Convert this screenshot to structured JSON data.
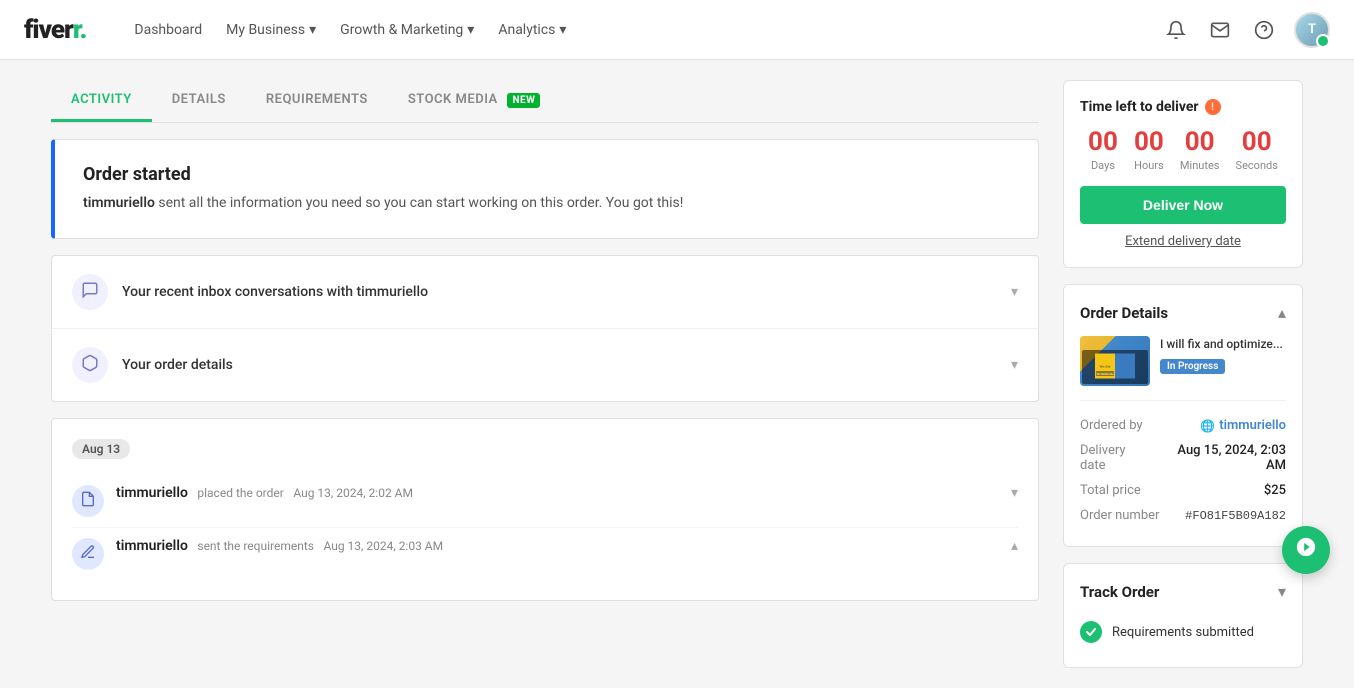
{
  "navbar": {
    "logo": "fiverr.",
    "links": [
      {
        "label": "Dashboard",
        "id": "dashboard"
      },
      {
        "label": "My Business",
        "id": "my-business",
        "dropdown": true
      },
      {
        "label": "Growth & Marketing",
        "id": "growth-marketing",
        "dropdown": true
      },
      {
        "label": "Analytics",
        "id": "analytics",
        "dropdown": true
      }
    ]
  },
  "tabs": [
    {
      "label": "ACTIVITY",
      "id": "activity",
      "active": true
    },
    {
      "label": "DETAILS",
      "id": "details"
    },
    {
      "label": "REQUIREMENTS",
      "id": "requirements"
    },
    {
      "label": "STOCK MEDIA",
      "id": "stock-media",
      "badge": "NEW"
    }
  ],
  "order_started": {
    "title": "Order started",
    "description": "timmuriello sent all the information you need so you can start working on this order. You got this!",
    "user": "timmuriello"
  },
  "accordion": {
    "items": [
      {
        "label": "Your recent inbox conversations with timmuriello",
        "icon": "💬",
        "id": "conversations"
      },
      {
        "label": "Your order details",
        "icon": "📦",
        "id": "order-details-accordion"
      }
    ]
  },
  "activity_log": {
    "date": "Aug 13",
    "items": [
      {
        "user": "timmuriello",
        "action": "placed the order",
        "timestamp": "Aug 13, 2024, 2:02 AM",
        "icon": "📄",
        "expanded": false
      },
      {
        "user": "timmuriello",
        "action": "sent the requirements",
        "timestamp": "Aug 13, 2024, 2:03 AM",
        "icon": "✏️",
        "expanded": true
      }
    ]
  },
  "timer": {
    "title": "Time left to deliver",
    "days": "00",
    "hours": "00",
    "minutes": "00",
    "seconds": "00",
    "deliver_btn": "Deliver Now",
    "extend_link": "Extend delivery date",
    "labels": {
      "days": "Days",
      "hours": "Hours",
      "minutes": "Minutes",
      "seconds": "Seconds"
    }
  },
  "order_details": {
    "title": "Order Details",
    "gig": {
      "title": "I will fix and optimize...",
      "status": "In Progress",
      "thumbnail_text": "Wix Mobile Site"
    },
    "ordered_by_label": "Ordered by",
    "ordered_by_user": "timmuriello",
    "delivery_date_label": "Delivery date",
    "delivery_date": "Aug 15, 2024, 2:03 AM",
    "total_price_label": "Total price",
    "total_price": "$25",
    "order_number_label": "Order number",
    "order_number": "#FO81F5B09A182"
  },
  "track_order": {
    "title": "Track Order",
    "items": [
      {
        "label": "Requirements submitted",
        "completed": true
      }
    ]
  }
}
